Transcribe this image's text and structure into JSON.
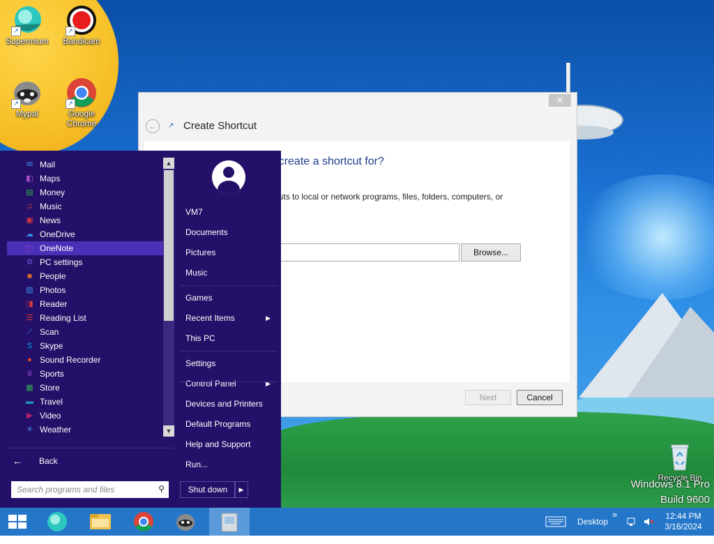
{
  "desktop_icons": [
    {
      "label": "Supermium",
      "icon": "supermium-icon",
      "color": "#2cc8c0"
    },
    {
      "label": "Bandicam",
      "icon": "bandicam-icon",
      "color": "#e81c1c"
    },
    {
      "label": "Mypal",
      "icon": "raccoon-icon",
      "color": "#7a7a7a"
    },
    {
      "label": "Google Chrome",
      "icon": "chrome-icon",
      "color": "#4285f4"
    },
    {
      "label": "Recycle Bin",
      "icon": "recycle-bin-icon",
      "color": "#dfe7ef"
    }
  ],
  "dialog": {
    "title": "Create Shortcut",
    "close": "✕",
    "question": "ike to create a shortcut for?",
    "description": "e shortcuts to local or network programs, files, folders, computers, or",
    "browse_label": "Browse...",
    "next_label": "Next",
    "cancel_label": "Cancel"
  },
  "start_menu": {
    "apps": [
      {
        "name": "Mail",
        "icon": "mail-icon",
        "glyph": "✉",
        "color": "#3a8ee6"
      },
      {
        "name": "Maps",
        "icon": "maps-icon",
        "glyph": "◧",
        "color": "#b04fd0"
      },
      {
        "name": "Money",
        "icon": "money-icon",
        "glyph": "▤",
        "color": "#2eaa4a"
      },
      {
        "name": "Music",
        "icon": "music-icon",
        "glyph": "♫",
        "color": "#e2492a"
      },
      {
        "name": "News",
        "icon": "news-icon",
        "glyph": "▣",
        "color": "#d83a3a"
      },
      {
        "name": "OneDrive",
        "icon": "onedrive-icon",
        "glyph": "☁",
        "color": "#3a8ee6"
      },
      {
        "name": "OneNote",
        "icon": "onenote-icon",
        "glyph": "◫",
        "color": "#8b3fbf"
      },
      {
        "name": "PC settings",
        "icon": "gear-icon",
        "glyph": "⚙",
        "color": "#6a5fd8"
      },
      {
        "name": "People",
        "icon": "people-icon",
        "glyph": "☻",
        "color": "#e5702a"
      },
      {
        "name": "Photos",
        "icon": "photos-icon",
        "glyph": "▨",
        "color": "#3a8ee6"
      },
      {
        "name": "Reader",
        "icon": "reader-icon",
        "glyph": "◨",
        "color": "#d83a3a"
      },
      {
        "name": "Reading List",
        "icon": "reading-list-icon",
        "glyph": "☰",
        "color": "#d83a3a"
      },
      {
        "name": "Scan",
        "icon": "scan-icon",
        "glyph": "⟋",
        "color": "#3a8ee6"
      },
      {
        "name": "Skype",
        "icon": "skype-icon",
        "glyph": "S",
        "color": "#00aff0"
      },
      {
        "name": "Sound Recorder",
        "icon": "microphone-icon",
        "glyph": "●",
        "color": "#e2492a"
      },
      {
        "name": "Sports",
        "icon": "trophy-icon",
        "glyph": "♛",
        "color": "#7a3fb8"
      },
      {
        "name": "Store",
        "icon": "store-icon",
        "glyph": "▦",
        "color": "#2eaa4a"
      },
      {
        "name": "Travel",
        "icon": "travel-icon",
        "glyph": "▬",
        "color": "#1a9ac0"
      },
      {
        "name": "Video",
        "icon": "video-icon",
        "glyph": "▶",
        "color": "#c0266a"
      },
      {
        "name": "Weather",
        "icon": "weather-icon",
        "glyph": "☀",
        "color": "#3a8ee6"
      }
    ],
    "selected_app": "OneNote",
    "back_label": "Back",
    "search_placeholder": "Search programs and files",
    "user_name": "VM7",
    "right_items": [
      {
        "label": "VM7",
        "top": 0
      },
      {
        "label": "Documents"
      },
      {
        "label": "Pictures"
      },
      {
        "label": "Music"
      },
      {
        "label": "Games"
      },
      {
        "label": "Recent Items",
        "submenu": true
      },
      {
        "label": "This PC"
      },
      {
        "label": "Settings"
      },
      {
        "label": "Control Panel",
        "submenu": true
      },
      {
        "label": "Devices and Printers"
      },
      {
        "label": "Default Programs"
      },
      {
        "label": "Help and Support"
      },
      {
        "label": "Run..."
      }
    ],
    "shutdown_label": "Shut down",
    "shutdown_arrow": "▶",
    "chevron": "▶"
  },
  "watermark": {
    "line1": "Windows 8.1 Pro",
    "line2": "Build 9600"
  },
  "taskbar": {
    "pinned": [
      {
        "name": "supermium-icon",
        "color": "#2cc8c0"
      },
      {
        "name": "file-explorer-icon",
        "color": "#f2c14e"
      },
      {
        "name": "chrome-icon",
        "color": "#4285f4"
      },
      {
        "name": "raccoon-icon",
        "color": "#7a7a7a"
      },
      {
        "name": "create-shortcut-icon",
        "color": "#d8dde3"
      }
    ],
    "desktop_label": "Desktop",
    "time": "12:44 PM",
    "date": "3/16/2024",
    "overflow": "»"
  }
}
